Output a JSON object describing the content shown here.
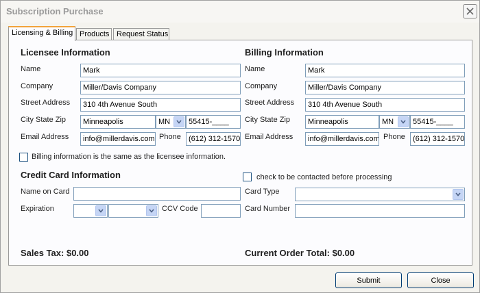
{
  "window": {
    "title": "Subscription Purchase"
  },
  "tabs": [
    {
      "label": "Licensing & Billing"
    },
    {
      "label": "Products"
    },
    {
      "label": "Request Status"
    }
  ],
  "licensee": {
    "heading": "Licensee Information",
    "labels": {
      "name": "Name",
      "company": "Company",
      "street": "Street Address",
      "city_state_zip": "City State Zip",
      "email": "Email Address",
      "phone": "Phone"
    },
    "name": "Mark",
    "company": "Miller/Davis Company",
    "street": "310 4th Avenue South",
    "city": "Minneapolis",
    "state": "MN",
    "zip": "55415-____",
    "email": "info@millerdavis.com",
    "phone": "(612) 312-1570"
  },
  "billing": {
    "heading": "Billing Information",
    "labels": {
      "name": "Name",
      "company": "Company",
      "street": "Street Address",
      "city_state_zip": "City State Zip",
      "email": "Email Address",
      "phone": "Phone"
    },
    "name": "Mark",
    "company": "Miller/Davis Company",
    "street": "310 4th Avenue South",
    "city": "Minneapolis",
    "state": "MN",
    "zip": "55415-____",
    "email": "info@millerdavis.com",
    "phone": "(612) 312-1570"
  },
  "same_as_licensee": {
    "label": "Billing information is the same as the licensee information.",
    "checked": false
  },
  "credit_card": {
    "heading": "Credit Card Information",
    "name_on_card_label": "Name on Card",
    "name_on_card": "",
    "expiration_label": "Expiration",
    "exp_month": "",
    "exp_year": "",
    "ccv_label": "CCV Code",
    "ccv": "",
    "contact_label": "check to be contacted before processing",
    "contact_checked": false,
    "card_type_label": "Card Type",
    "card_type": "",
    "card_number_label": "Card Number",
    "card_number": ""
  },
  "totals": {
    "sales_tax": "Sales Tax: $0.00",
    "order_total": "Current Order Total: $0.00"
  },
  "buttons": {
    "submit": "Submit",
    "close": "Close"
  },
  "icons": {
    "close": "close-icon",
    "dropdown": "chevron-down-icon"
  }
}
